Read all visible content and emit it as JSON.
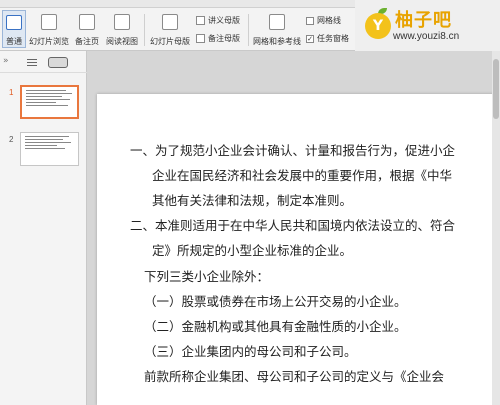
{
  "ribbon": {
    "normal_label": "普通",
    "slide_sorter_label": "幻灯片浏览",
    "notes_page_label": "备注页",
    "reading_view_label": "阅读视图",
    "slide_master_label": "幻灯片母版",
    "handout_master_label": "讲义母版",
    "notes_master_label": "备注母版",
    "grid_guides_label": "网格和参考线",
    "gridlines_label": "网格线",
    "taskpane_label": "任务窗格",
    "taskpane_checked": true,
    "gridlines_checked": false
  },
  "watermark": {
    "name": "柚子吧",
    "url": "www.youzi8.cn",
    "logo_letter": "Y"
  },
  "panel": {
    "thumbnails": [
      {
        "number": "1",
        "selected": true
      },
      {
        "number": "2",
        "selected": false
      }
    ]
  },
  "slide": {
    "lines": [
      "一、为了规范小企业会计确认、计量和报告行为，促进小企",
      "企业在国民经济和社会发展中的重要作用，根据《中华",
      "其他有关法律和法规，制定本准则。",
      "二、本准则适用于在中华人民共和国境内依法设立的、符合",
      "定》所规定的小型企业标准的企业。",
      "下列三类小企业除外：",
      "（一）股票或债券在市场上公开交易的小企业。",
      "（二）金融机构或其他具有金融性质的小企业。",
      "（三）企业集团内的母公司和子公司。",
      "前款所称企业集团、母公司和子公司的定义与《企业会"
    ]
  }
}
